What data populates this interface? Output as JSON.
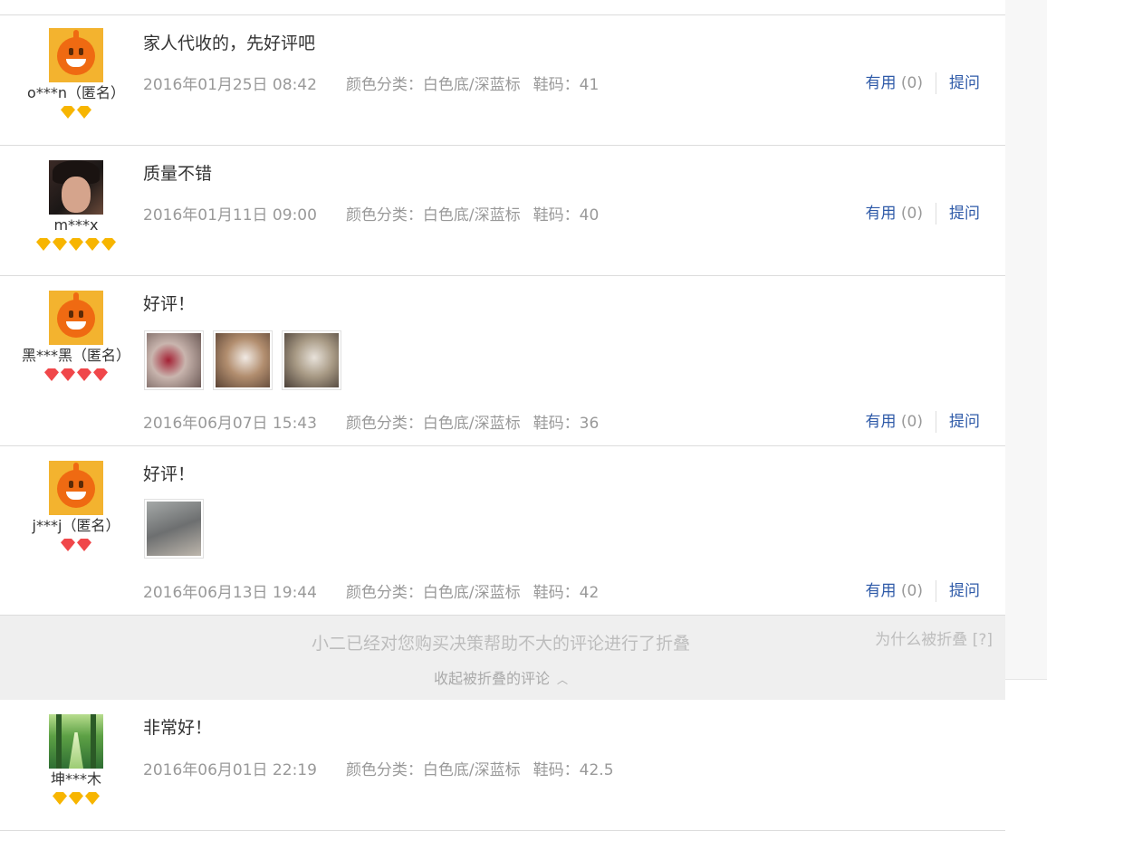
{
  "reviews": [
    {
      "username": "o***n（匿名）",
      "avatar": "default-orange-avatar",
      "badge_color": "gold",
      "badge_count": 2,
      "text": "家人代收的，先好评吧",
      "date": "2016年01月25日 08:42",
      "sku": "颜色分类：白色底/深蓝标",
      "size": "鞋码：41",
      "useful_label": "有用",
      "useful_count": "(0)",
      "ask_label": "提问"
    },
    {
      "username": "m***x",
      "avatar": "user-photo-avatar",
      "badge_color": "gold",
      "badge_count": 5,
      "text": "质量不错",
      "date": "2016年01月11日 09:00",
      "sku": "颜色分类：白色底/深蓝标",
      "size": "鞋码：40",
      "useful_label": "有用",
      "useful_count": "(0)",
      "ask_label": "提问"
    },
    {
      "username": "黑***黑（匿名）",
      "avatar": "default-orange-avatar",
      "badge_color": "red",
      "badge_count": 4,
      "text": "好评！",
      "images": [
        "photo-1",
        "photo-2",
        "photo-3"
      ],
      "date": "2016年06月07日 15:43",
      "sku": "颜色分类：白色底/深蓝标",
      "size": "鞋码：36",
      "useful_label": "有用",
      "useful_count": "(0)",
      "ask_label": "提问"
    },
    {
      "username": "j***j（匿名）",
      "avatar": "default-orange-avatar",
      "badge_color": "red",
      "badge_count": 2,
      "text": "好评！",
      "images": [
        "photo-1"
      ],
      "date": "2016年06月13日 19:44",
      "sku": "颜色分类：白色底/深蓝标",
      "size": "鞋码：42",
      "useful_label": "有用",
      "useful_count": "(0)",
      "ask_label": "提问"
    }
  ],
  "folded_notice": {
    "message": "小二已经对您购买决策帮助不大的评论进行了折叠",
    "collapse_label": "收起被折叠的评论",
    "collapse_icon": "chevron-up-icon",
    "why_label": "为什么被折叠 [?]"
  },
  "folded_reviews": [
    {
      "username": "坤***木",
      "avatar": "forest-photo-avatar",
      "badge_color": "gold",
      "badge_count": 3,
      "text": "非常好！",
      "date": "2016年06月01日 22:19",
      "sku": "颜色分类：白色底/深蓝标",
      "size": "鞋码：42.5"
    }
  ],
  "colors": {
    "link": "#2e5aa8",
    "meta": "#999999",
    "badge_gold": "#f7b500",
    "badge_red": "#f0474a",
    "folded_bg": "#efefef"
  }
}
